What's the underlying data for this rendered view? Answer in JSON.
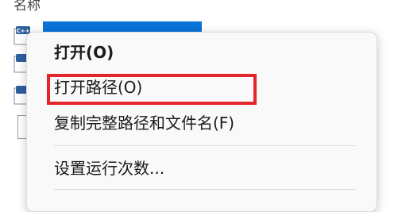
{
  "explorer": {
    "column_header": "名称",
    "file_icon_label": "C++"
  },
  "context_menu": {
    "items": [
      {
        "label": "打开(O)",
        "bold": true
      },
      {
        "label": "打开路径(O)"
      },
      {
        "label": "复制完整路径和文件名(F)"
      },
      {
        "label": "设置运行次数..."
      }
    ]
  },
  "colors": {
    "selection": "#0a73d8",
    "highlight_box": "#e3262b",
    "menu_background": "#f9f9f9"
  }
}
